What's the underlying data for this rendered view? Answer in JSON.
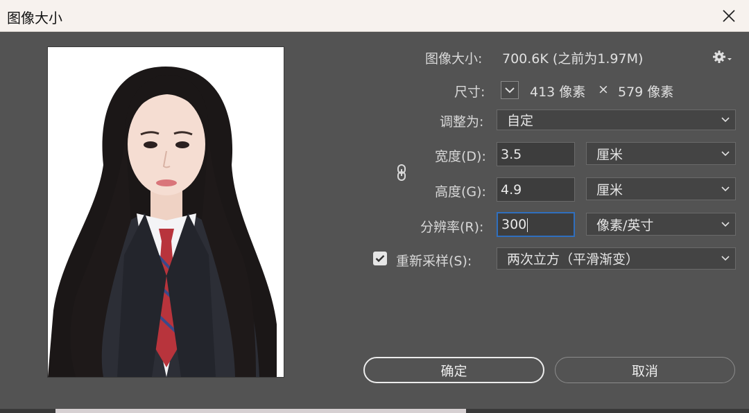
{
  "window": {
    "title": "图像大小"
  },
  "info": {
    "image_size_label": "图像大小:",
    "image_size_value": "700.6K (之前为1.97M)",
    "dimensions_label": "尺寸:",
    "width_px": "413 像素",
    "times": "×",
    "height_px": "579 像素"
  },
  "fit_to": {
    "label": "调整为:",
    "value": "自定"
  },
  "width": {
    "label": "宽度(D):",
    "value": "3.5",
    "unit": "厘米"
  },
  "height": {
    "label": "高度(G):",
    "value": "4.9",
    "unit": "厘米"
  },
  "resolution": {
    "label": "分辨率(R):",
    "value": "300",
    "unit": "像素/英寸"
  },
  "resample": {
    "label": "重新采样(S):",
    "checked": true,
    "value": "两次立方（平滑渐变）"
  },
  "buttons": {
    "ok": "确定",
    "cancel": "取消"
  },
  "colors": {
    "panel": "#535353",
    "titlebar": "#f7f2ee",
    "focus": "#2f6fbf"
  }
}
